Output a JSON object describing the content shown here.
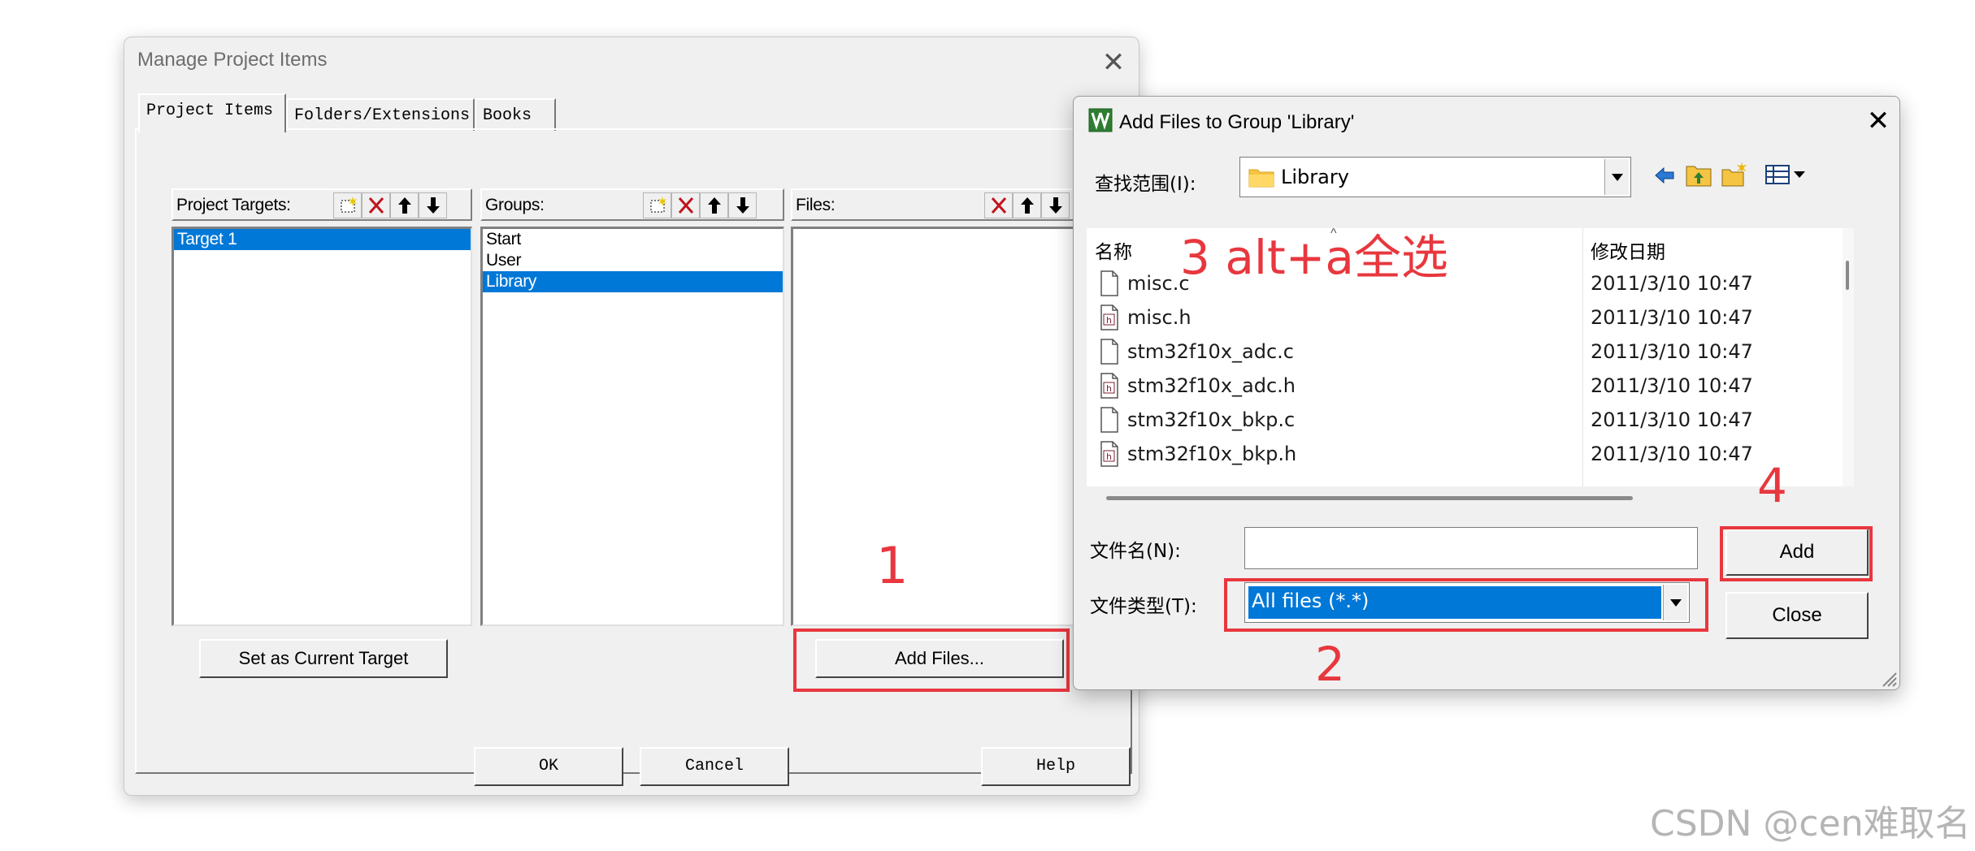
{
  "manage_dialog": {
    "title": "Manage Project Items",
    "close": "✕",
    "tabs": [
      "Project Items",
      "Folders/Extensions",
      "Books"
    ],
    "targets": {
      "header": "Project Targets:",
      "items": [
        "Target 1"
      ]
    },
    "groups": {
      "header": "Groups:",
      "items": [
        "Start",
        "User",
        "Library"
      ]
    },
    "files": {
      "header": "Files:",
      "items": []
    },
    "set_current_target": "Set as Current Target",
    "add_files": "Add Files...",
    "ok": "OK",
    "cancel": "Cancel",
    "help": "Help"
  },
  "add_files_dialog": {
    "title": "Add Files to Group 'Library'",
    "close": "✕",
    "look_in_label": "查找范围(I):",
    "look_in_value": "Library",
    "columns": {
      "name": "名称",
      "modified": "修改日期"
    },
    "files": [
      {
        "name": "misc.c",
        "date": "2011/3/10 10:47",
        "icon": "c-file-icon"
      },
      {
        "name": "misc.h",
        "date": "2011/3/10 10:47",
        "icon": "h-file-icon"
      },
      {
        "name": "stm32f10x_adc.c",
        "date": "2011/3/10 10:47",
        "icon": "c-file-icon"
      },
      {
        "name": "stm32f10x_adc.h",
        "date": "2011/3/10 10:47",
        "icon": "h-file-icon"
      },
      {
        "name": "stm32f10x_bkp.c",
        "date": "2011/3/10 10:47",
        "icon": "c-file-icon"
      },
      {
        "name": "stm32f10x_bkp.h",
        "date": "2011/3/10 10:47",
        "icon": "h-file-icon"
      }
    ],
    "filename_label": "文件名(N):",
    "filename_value": "",
    "filetype_label": "文件类型(T):",
    "filetype_value": "All files (*.*)",
    "add": "Add",
    "close_btn": "Close"
  },
  "annotations": {
    "step1": "1",
    "step2": "2",
    "step3": "3 alt+a全选",
    "step4": "4",
    "color": "#e8373e"
  },
  "watermark": "CSDN @cen难取名"
}
